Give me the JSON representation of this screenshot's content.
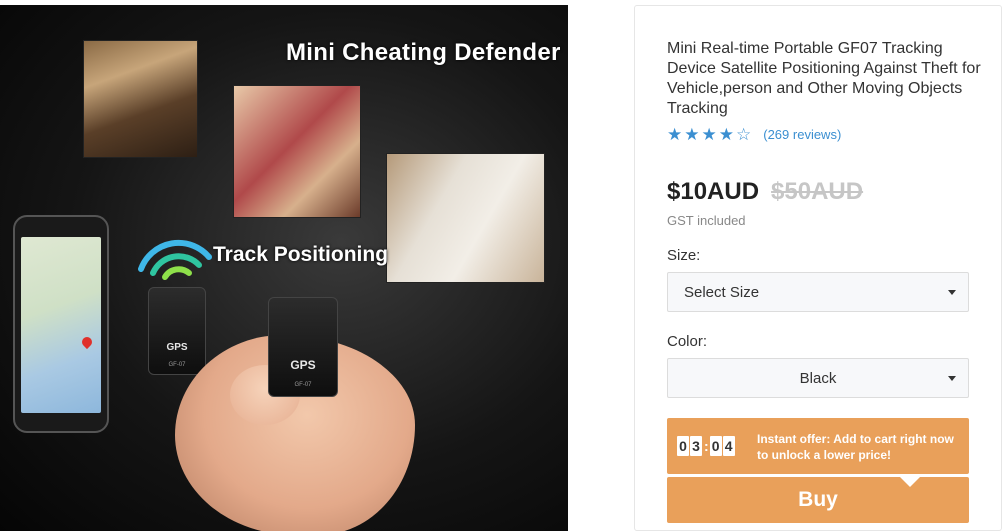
{
  "hero": {
    "headline": "Mini Cheating Defender",
    "track_label": "Track Positioning",
    "device_label_1": "GPS",
    "device_label_2": "GPS",
    "device_model_1": "GF-07",
    "device_model_2": "GF-07"
  },
  "product": {
    "title": "Mini Real-time Portable GF07 Tracking Device Satellite Positioning Against Theft for Vehicle,person and Other Moving Objects Tracking",
    "rating": 4,
    "rating_max": 5,
    "reviews": "(269 reviews)",
    "price": "$10AUD",
    "compare_price": "$50AUD",
    "tax_note": "GST included"
  },
  "options": {
    "size_label": "Size:",
    "size_value": "Select Size",
    "color_label": "Color:",
    "color_value": "Black"
  },
  "offer": {
    "timer_digits": [
      "0",
      "3",
      "0",
      "4"
    ],
    "timer_separator": ":",
    "text": "Instant offer: Add to cart right now to unlock a lower price!"
  },
  "buy_label": "Buy",
  "colors": {
    "accent": "#e9a05a",
    "rating": "#3b8fd1",
    "price": "#222222",
    "compare_price": "#c6c6c6"
  },
  "icons": {
    "star": "star-icon",
    "caret": "caret-down-icon",
    "signal": "wifi-signal-icon"
  }
}
